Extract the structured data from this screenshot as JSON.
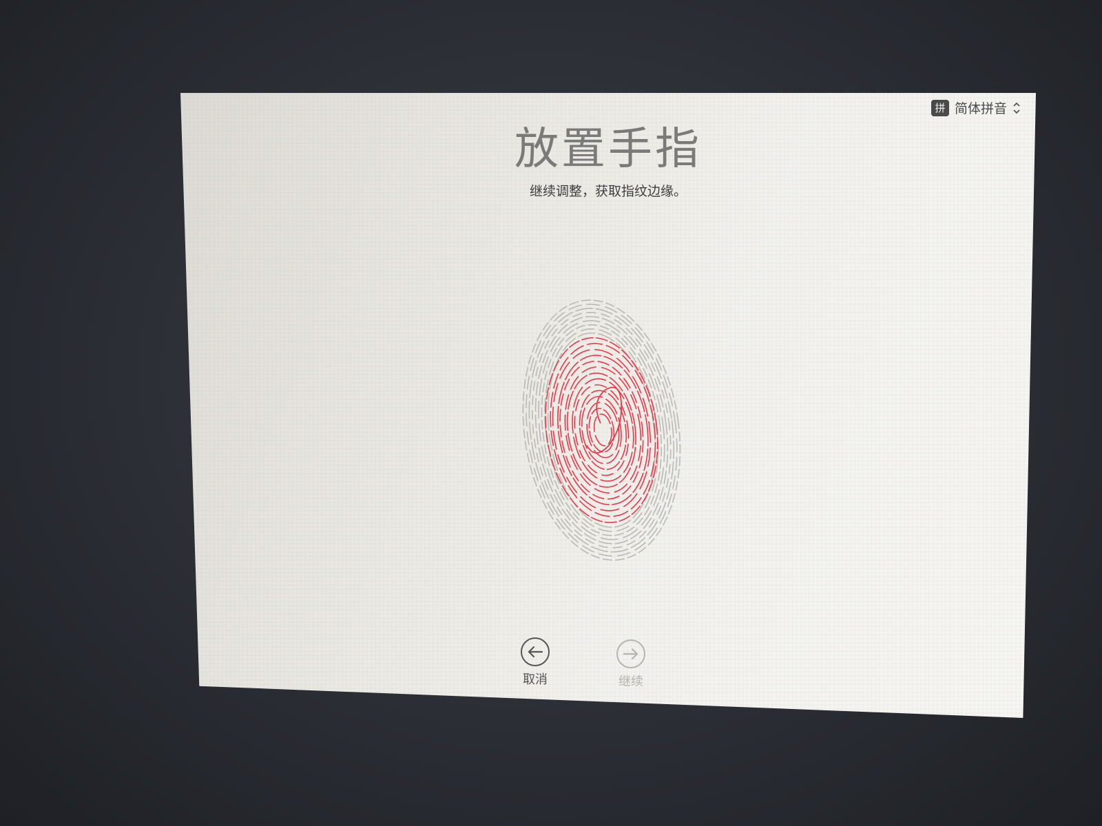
{
  "input_source": {
    "badge": "拼",
    "label": "简体拼音",
    "icon": "chevron-updown-icon"
  },
  "page": {
    "title": "放置手指",
    "subtitle": "继续调整，获取指纹边缘。"
  },
  "fingerprint": {
    "icon": "fingerprint-icon",
    "captured_color": "#e8394a",
    "uncaptured_color": "#b9b9b5"
  },
  "nav": {
    "back_label": "取消",
    "back_icon": "arrow-left-circle-icon",
    "next_label": "继续",
    "next_icon": "arrow-right-circle-icon",
    "next_enabled": false
  }
}
